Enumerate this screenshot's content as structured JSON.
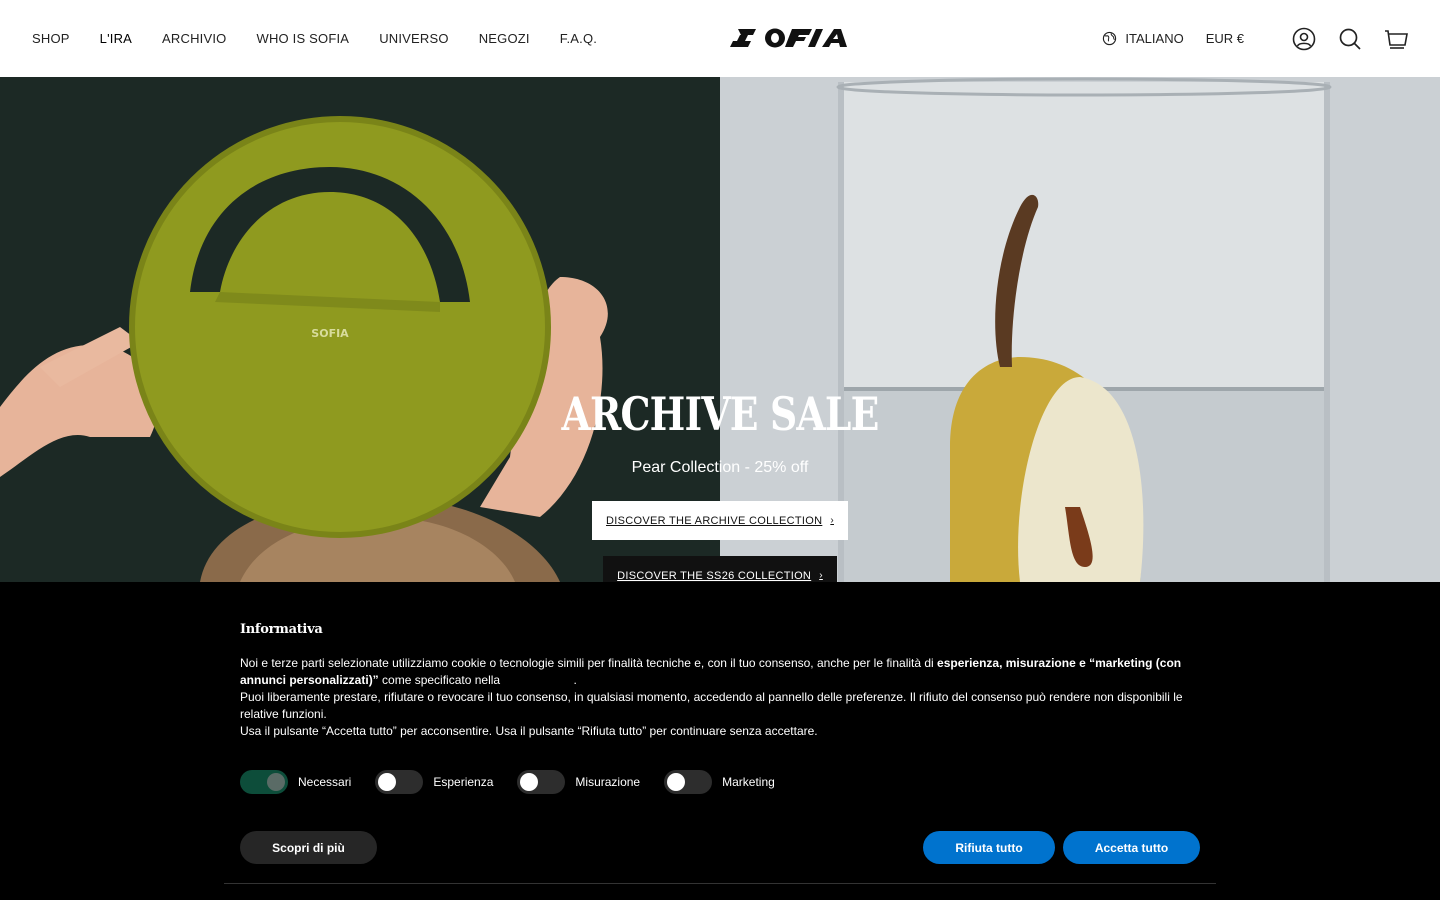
{
  "header": {
    "nav": [
      "SHOP",
      "L'IRA",
      "ARCHIVIO",
      "WHO IS SOFIA",
      "UNIVERSO",
      "NEGOZI",
      "F.A.Q."
    ],
    "logo_text": "SOFIA",
    "language": "ITALIANO",
    "currency": "EUR €",
    "icons": [
      "globe-icon",
      "account-icon",
      "search-icon",
      "cart-icon"
    ]
  },
  "hero": {
    "title": "ARCHIVE SALE",
    "subtitle": "Pear Collection - 25% off",
    "bag_logo": "SOFIA",
    "primary_button": "DISCOVER THE ARCHIVE COLLECTION",
    "secondary_button": "DISCOVER THE SS26 COLLECTION"
  },
  "cookie": {
    "title": "Informativa",
    "p1_start": "Noi e terze parti selezionate utilizziamo cookie o tecnologie simili per finalità tecniche e, con il tuo consenso, anche per le finalità di ",
    "p1_bold": "esperienza, misurazione e “marketing (con annunci personalizzati)”",
    "p1_end": " come specificato nella",
    "p1_period": ".",
    "p2": "Puoi liberamente prestare, rifiutare o revocare il tuo consenso, in qualsiasi momento, accedendo al pannello delle preferenze. Il rifiuto del consenso può rendere non disponibili le relative funzioni.",
    "p3": "Usa il pulsante “Accetta tutto” per acconsentire. Usa il pulsante “Rifiuta tutto” per continuare senza accettare.",
    "toggles": {
      "necessari": "Necessari",
      "esperienza": "Esperienza",
      "misurazione": "Misurazione",
      "marketing": "Marketing"
    },
    "more_button": "Scopri di più",
    "reject_button": "Rifiuta tutto",
    "accept_button": "Accetta tutto"
  },
  "colors": {
    "accent": "#0073ce",
    "banner_bg": "#000000",
    "toggle_on": "#0d4d3a",
    "bag": "#8f9a1f"
  }
}
